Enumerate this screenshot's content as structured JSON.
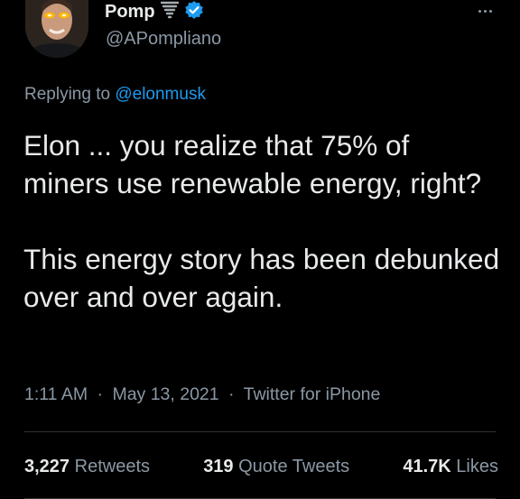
{
  "tweet": {
    "author": {
      "display_name": "Pomp",
      "handle": "@APompliano",
      "badges": [
        "tornado-icon",
        "verified-badge-icon"
      ]
    },
    "menu_icon": "more-options-icon",
    "replying_prefix": "Replying to",
    "replying_to": "@elonmusk",
    "text_paragraphs": [
      "Elon ... you realize that 75% of miners use renewable energy, right?",
      "This energy story has been debunked over and over again."
    ],
    "time": "1:11 AM",
    "date": "May 13, 2021",
    "source": "Twitter for iPhone",
    "separator": "·",
    "stats": {
      "retweets": {
        "count": "3,227",
        "label": "Retweets"
      },
      "quotes": {
        "count": "319",
        "label": "Quote Tweets"
      },
      "likes": {
        "count": "41.7K",
        "label": "Likes"
      }
    }
  },
  "colors": {
    "background": "#000000",
    "primary_text": "#e7e9ea",
    "secondary_text": "#8b98a5",
    "accent": "#1d9bf0",
    "divider": "#2f3336"
  }
}
